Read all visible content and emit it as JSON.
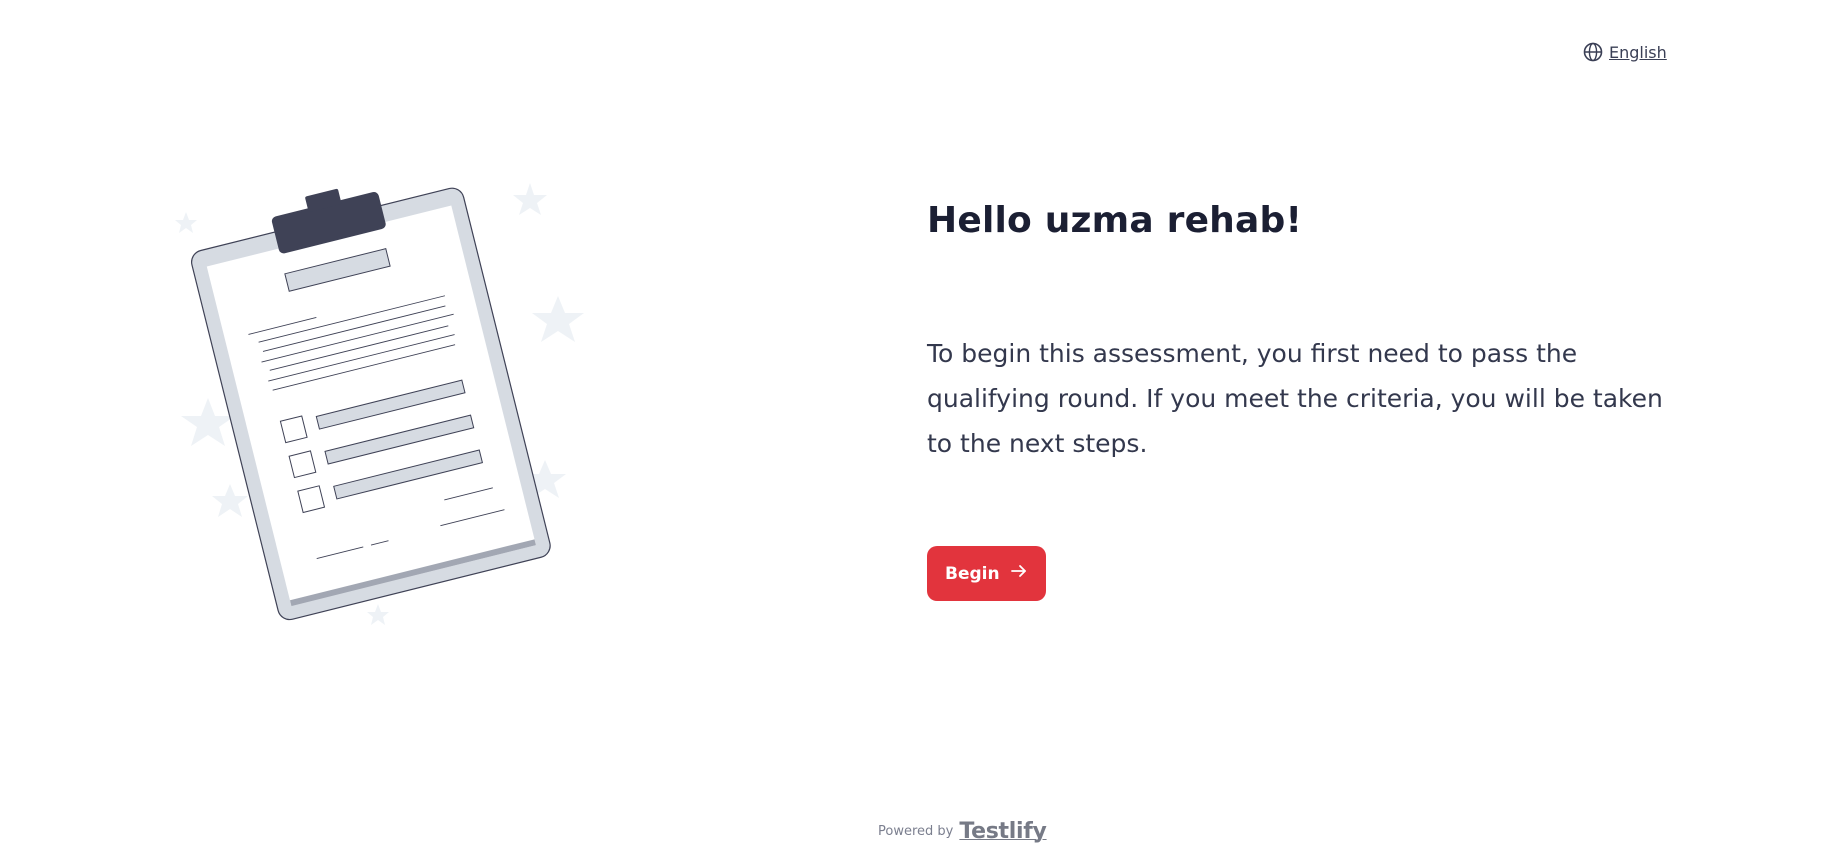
{
  "header": {
    "language_label": "English",
    "language_icon": "globe-icon"
  },
  "main": {
    "greeting": "Hello uzma rehab!",
    "intro": "To begin this assessment, you first need to pass the qualifying round. If you meet the criteria, you will be taken to the next steps.",
    "begin_label": "Begin",
    "begin_icon": "arrow-right-icon",
    "illustration": "clipboard-checklist-illustration"
  },
  "footer": {
    "powered_by": "Powered by",
    "brand": "Testlify"
  },
  "colors": {
    "accent": "#e2343d",
    "text_dark": "#1b1f33",
    "clipboard_clip": "#3f4256",
    "star": "#eef2f6"
  }
}
